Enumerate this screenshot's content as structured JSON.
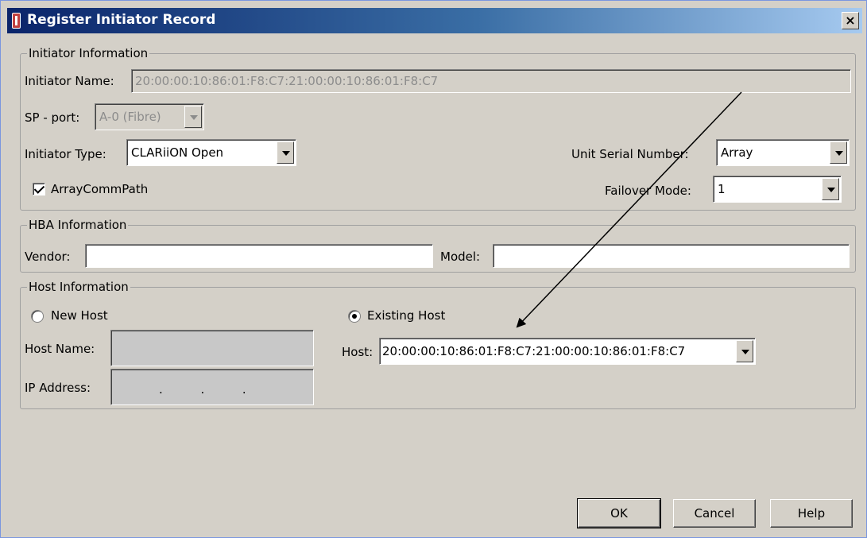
{
  "window": {
    "title": "Register Initiator Record",
    "close_label": "×"
  },
  "initiator": {
    "legend": "Initiator Information",
    "name_label": "Initiator Name:",
    "name_value": "20:00:00:10:86:01:F8:C7:21:00:00:10:86:01:F8:C7",
    "sp_port_label": "SP - port:",
    "sp_port_value": "A-0 (Fibre)",
    "type_label": "Initiator Type:",
    "type_value": "CLARiiON Open",
    "serial_label": "Unit Serial Number:",
    "serial_value": "Array",
    "arraycommpath_label": "ArrayCommPath",
    "arraycommpath_checked": true,
    "failover_label": "Failover Mode:",
    "failover_value": "1"
  },
  "hba": {
    "legend": "HBA Information",
    "vendor_label": "Vendor:",
    "vendor_value": "",
    "model_label": "Model:",
    "model_value": ""
  },
  "host": {
    "legend": "Host Information",
    "new_host_label": "New Host",
    "existing_host_label": "Existing Host",
    "selected": "existing",
    "host_name_label": "Host Name:",
    "ip_label": "IP Address:",
    "ip_value": ".          .          .",
    "host_label": "Host:",
    "host_value": "20:00:00:10:86:01:F8:C7:21:00:00:10:86:01:F8:C7"
  },
  "buttons": {
    "ok": "OK",
    "cancel": "Cancel",
    "help": "Help"
  },
  "colors": {
    "titlebar_start": "#0a246a",
    "titlebar_end": "#a6caf0",
    "dialog_bg": "#d4d0c8"
  }
}
